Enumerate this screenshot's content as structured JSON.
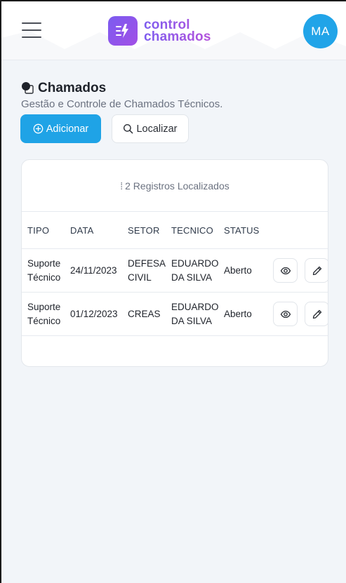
{
  "header": {
    "brand_line1": "control",
    "brand_line2": "chamados",
    "avatar_initials": "MA",
    "icons": [
      "menu-icon",
      "lightning-logo-icon"
    ]
  },
  "page": {
    "title": "Chamados",
    "subtitle": "Gestão e Controle de Chamados Técnicos.",
    "add_label": "Adicionar",
    "search_label": "Localizar"
  },
  "table": {
    "records_label": "2 Registros Localizados",
    "columns": [
      "TIPO",
      "DATA",
      "SETOR",
      "TECNICO",
      "STATUS"
    ],
    "rows": [
      {
        "tipo_1": "Suporte",
        "tipo_2": "Técnico",
        "data": "24/11/2023",
        "setor_1": "DEFESA",
        "setor_2": "CIVIL",
        "tecnico_1": "EDUARDO",
        "tecnico_2": "DA SILVA",
        "status": "Aberto"
      },
      {
        "tipo_1": "Suporte",
        "tipo_2": "Técnico",
        "data": "01/12/2023",
        "setor_1": "CREAS",
        "setor_2": "",
        "tecnico_1": "EDUARDO",
        "tecnico_2": "DA SILVA",
        "status": "Aberto"
      }
    ]
  },
  "colors": {
    "accent": "#1fa3e6",
    "brand_start": "#7b5cf0",
    "brand_end": "#b553dc",
    "background": "#f2f5f9"
  }
}
